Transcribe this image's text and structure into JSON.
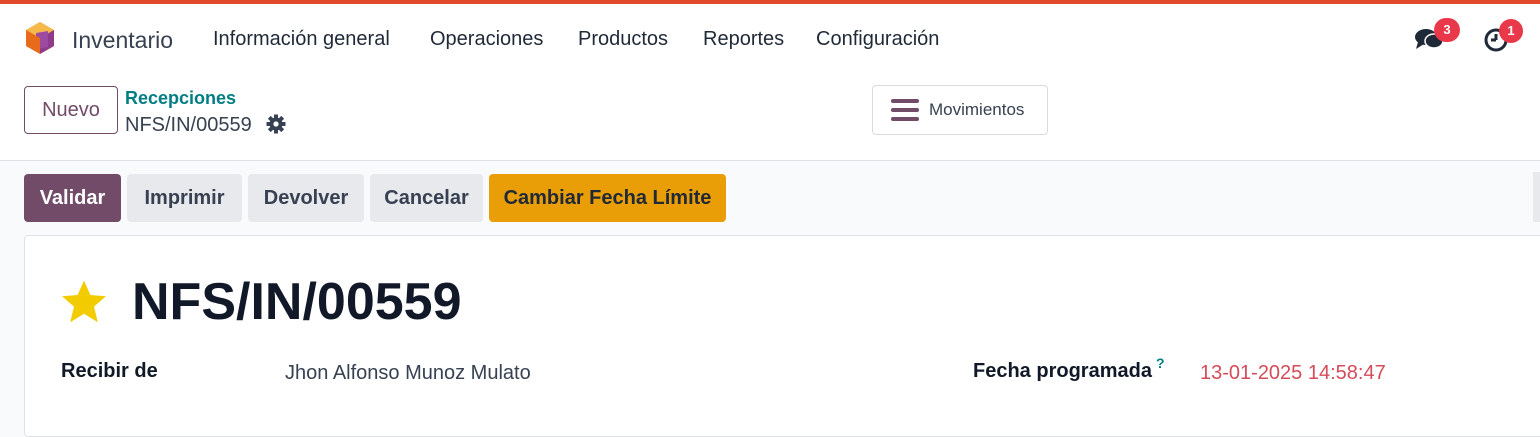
{
  "navbar": {
    "app_name": "Inventario",
    "menu": [
      "Información general",
      "Operaciones",
      "Productos",
      "Reportes",
      "Configuración"
    ],
    "messages_badge": "3",
    "activities_badge": "1",
    "accent_color": "#e04a2a"
  },
  "control_panel": {
    "new_button": "Nuevo",
    "breadcrumb_parent": "Recepciones",
    "breadcrumb_current": "NFS/IN/00559",
    "moves_button": "Movimientos"
  },
  "actions": {
    "validate": "Validar",
    "print": "Imprimir",
    "return": "Devolver",
    "cancel": "Cancelar",
    "change_deadline": "Cambiar Fecha Límite"
  },
  "record": {
    "name": "NFS/IN/00559",
    "partner_label": "Recibir de",
    "partner_value": "Jhon Alfonso Munoz Mulato",
    "scheduled_label": "Fecha programada",
    "scheduled_tip": "?",
    "scheduled_value": "13-01-2025 14:58:47",
    "date_color": "#d44c59"
  },
  "colors": {
    "primary": "#714b67",
    "warning": "#e99d06",
    "link": "#017e84"
  }
}
